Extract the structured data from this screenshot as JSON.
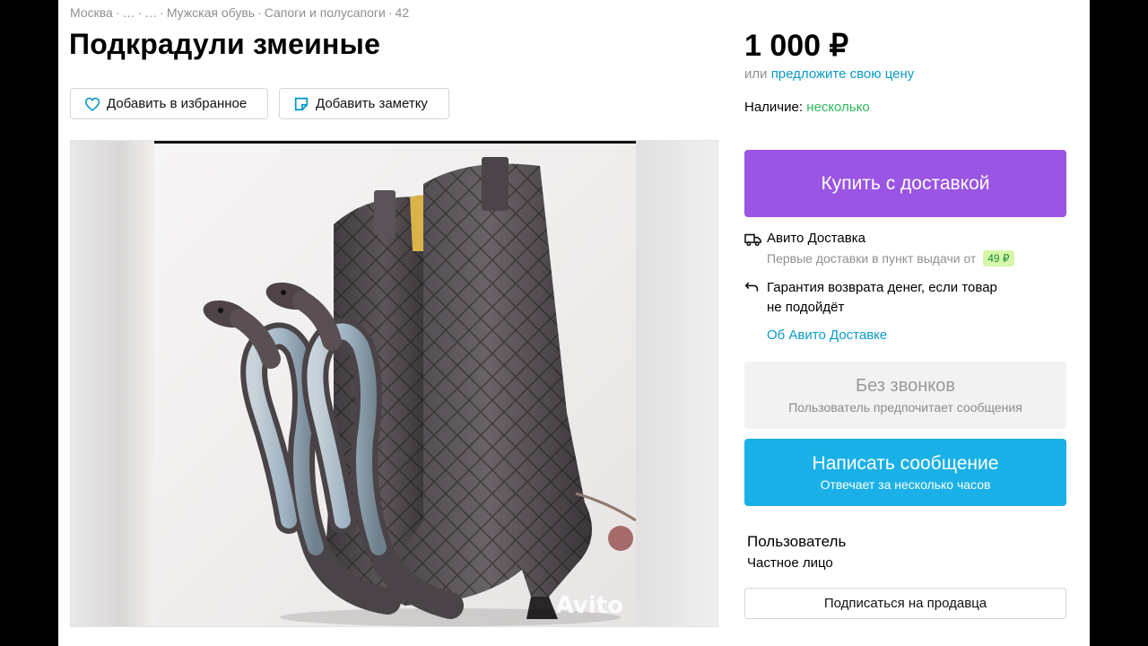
{
  "breadcrumb": {
    "items": [
      "Москва",
      "…",
      "…",
      "Мужская обувь",
      "Сапоги и полусапоги",
      "42"
    ],
    "separator": "·"
  },
  "listing": {
    "title": "Подкрадули змеиные",
    "actions": {
      "favorite_label": "Добавить в избранное",
      "note_label": "Добавить заметку"
    },
    "photo": {
      "watermark": "Avito"
    }
  },
  "sidebar": {
    "price": "1 000 ₽",
    "offer_prefix": "или",
    "offer_link": "предложите свою цену",
    "availability_label": "Наличие:",
    "availability_value": "несколько",
    "buy_button": "Купить с доставкой",
    "delivery": {
      "title": "Авито Доставка",
      "subtitle": "Первые доставки в пункт выдачи от",
      "badge": "49 ₽",
      "guarantee_line1": "Гарантия возврата денег, если товар",
      "guarantee_line2": "не подойдёт",
      "about_link": "Об Авито Доставке"
    },
    "no_calls": {
      "title": "Без звонков",
      "subtitle": "Пользователь предпочитает сообщения"
    },
    "message_button": {
      "title": "Написать сообщение",
      "subtitle": "Отвечает за несколько часов"
    },
    "seller": {
      "name": "Пользователь",
      "type": "Частное лицо",
      "subscribe_button": "Подписаться на продавца"
    }
  },
  "colors": {
    "buy_button": "#9b55e4",
    "message_button": "#1ab1e8",
    "link": "#0a9ac8",
    "availability": "#2fb65b"
  },
  "icons": [
    "heart-icon",
    "note-icon",
    "truck-icon",
    "return-arrow-icon",
    "avito-logo-icon"
  ]
}
